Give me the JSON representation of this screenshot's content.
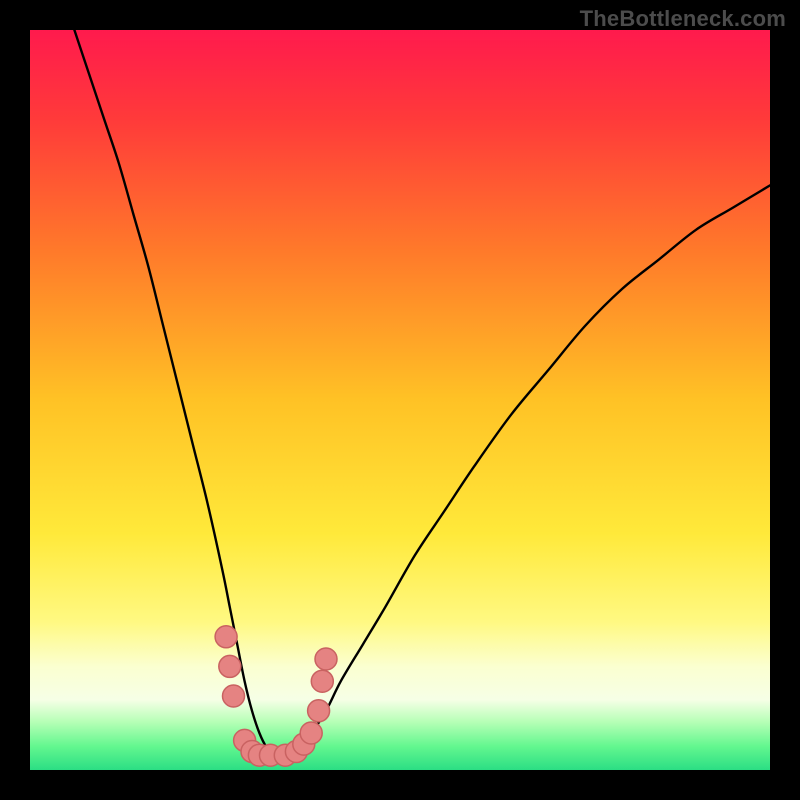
{
  "watermark": "TheBottleneck.com",
  "colors": {
    "frame": "#000000",
    "curve": "#000000",
    "marker_fill": "#e58382",
    "marker_stroke": "#c96261",
    "gradient_stops": [
      {
        "offset": 0.0,
        "color": "#ff1a4d"
      },
      {
        "offset": 0.12,
        "color": "#ff3a3a"
      },
      {
        "offset": 0.3,
        "color": "#ff7a2a"
      },
      {
        "offset": 0.5,
        "color": "#ffc225"
      },
      {
        "offset": 0.68,
        "color": "#ffe93a"
      },
      {
        "offset": 0.8,
        "color": "#fff982"
      },
      {
        "offset": 0.86,
        "color": "#fbffd0"
      },
      {
        "offset": 0.905,
        "color": "#f6ffe6"
      },
      {
        "offset": 0.935,
        "color": "#b6ffb6"
      },
      {
        "offset": 0.968,
        "color": "#63f78f"
      },
      {
        "offset": 1.0,
        "color": "#2bde84"
      }
    ]
  },
  "chart_data": {
    "type": "line",
    "title": "",
    "xlabel": "",
    "ylabel": "",
    "xlim": [
      0,
      100
    ],
    "ylim": [
      0,
      100
    ],
    "series": [
      {
        "name": "bottleneck-curve",
        "x": [
          6,
          8,
          10,
          12,
          14,
          16,
          18,
          20,
          22,
          24,
          26,
          27,
          28,
          29,
          30,
          31,
          32,
          33,
          34,
          35,
          36,
          38,
          40,
          42,
          45,
          48,
          52,
          56,
          60,
          65,
          70,
          75,
          80,
          85,
          90,
          95,
          100
        ],
        "y": [
          100,
          94,
          88,
          82,
          75,
          68,
          60,
          52,
          44,
          36,
          27,
          22,
          17,
          12,
          8,
          5,
          3,
          2,
          2,
          2,
          3,
          5,
          8,
          12,
          17,
          22,
          29,
          35,
          41,
          48,
          54,
          60,
          65,
          69,
          73,
          76,
          79
        ]
      }
    ],
    "markers": {
      "name": "highlighted-points",
      "points": [
        {
          "x": 26.5,
          "y": 18
        },
        {
          "x": 27.0,
          "y": 14
        },
        {
          "x": 27.5,
          "y": 10
        },
        {
          "x": 29.0,
          "y": 4
        },
        {
          "x": 30.0,
          "y": 2.5
        },
        {
          "x": 31.0,
          "y": 2
        },
        {
          "x": 32.5,
          "y": 2
        },
        {
          "x": 34.5,
          "y": 2
        },
        {
          "x": 36.0,
          "y": 2.5
        },
        {
          "x": 37.0,
          "y": 3.5
        },
        {
          "x": 38.0,
          "y": 5
        },
        {
          "x": 39.0,
          "y": 8
        },
        {
          "x": 39.5,
          "y": 12
        },
        {
          "x": 40.0,
          "y": 15
        }
      ]
    }
  }
}
